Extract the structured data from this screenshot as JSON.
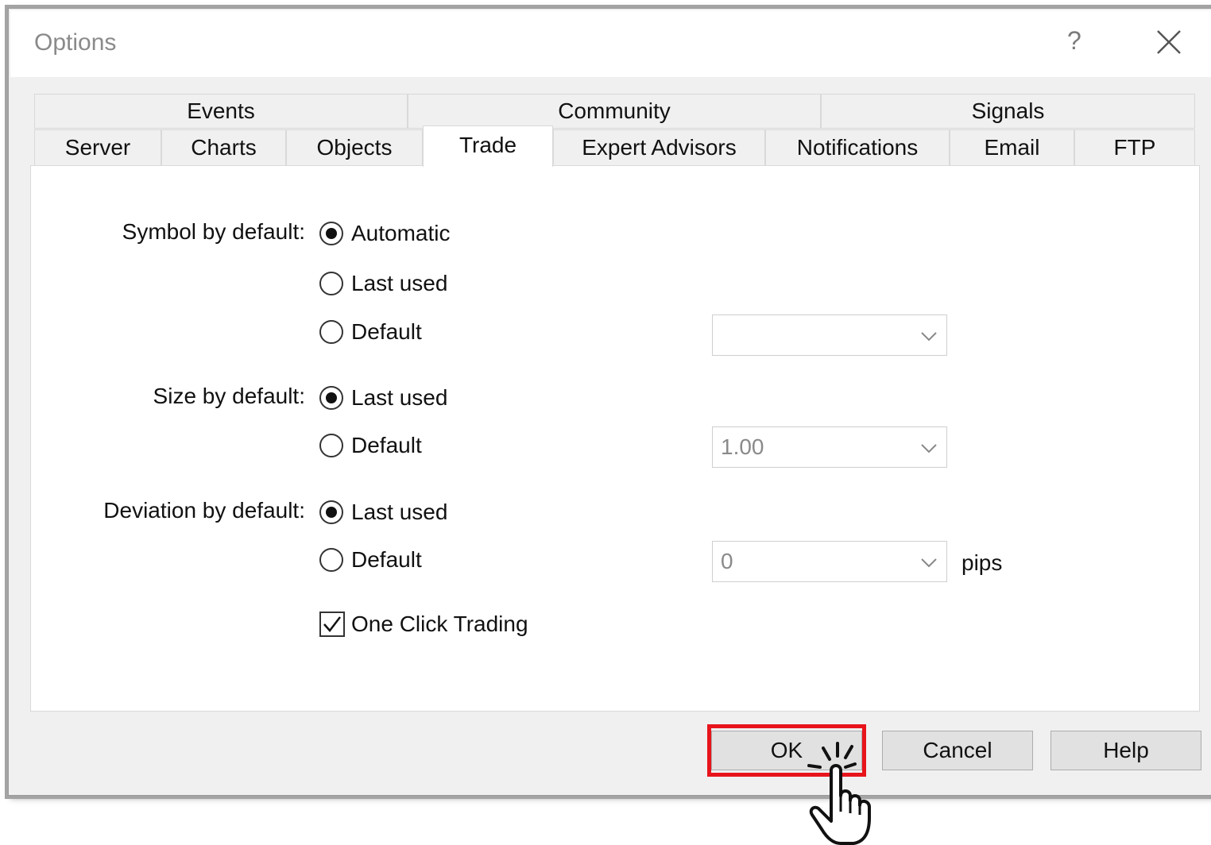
{
  "window": {
    "title": "Options",
    "help_glyph": "?"
  },
  "tabs": {
    "row1": [
      {
        "label": "Events"
      },
      {
        "label": "Community"
      },
      {
        "label": "Signals"
      }
    ],
    "row2": [
      {
        "label": "Server"
      },
      {
        "label": "Charts"
      },
      {
        "label": "Objects"
      },
      {
        "label": "Trade",
        "active": true
      },
      {
        "label": "Expert Advisors"
      },
      {
        "label": "Notifications"
      },
      {
        "label": "Email"
      },
      {
        "label": "FTP"
      }
    ]
  },
  "trade": {
    "symbol": {
      "label": "Symbol by default:",
      "options": [
        "Automatic",
        "Last used",
        "Default"
      ],
      "selected": "Automatic",
      "default_value": ""
    },
    "size": {
      "label": "Size by default:",
      "options": [
        "Last used",
        "Default"
      ],
      "selected": "Last used",
      "default_value": "1.00"
    },
    "deviation": {
      "label": "Deviation by default:",
      "options": [
        "Last used",
        "Default"
      ],
      "selected": "Last used",
      "default_value": "0",
      "unit": "pips"
    },
    "one_click": {
      "label": "One Click Trading",
      "checked": true
    }
  },
  "buttons": {
    "ok": "OK",
    "cancel": "Cancel",
    "help": "Help"
  },
  "colors": {
    "highlight": "#e8141c"
  },
  "icons": {
    "close": "close-icon",
    "dropdown": "chevron-down-icon",
    "cursor": "hand-pointer-icon"
  }
}
